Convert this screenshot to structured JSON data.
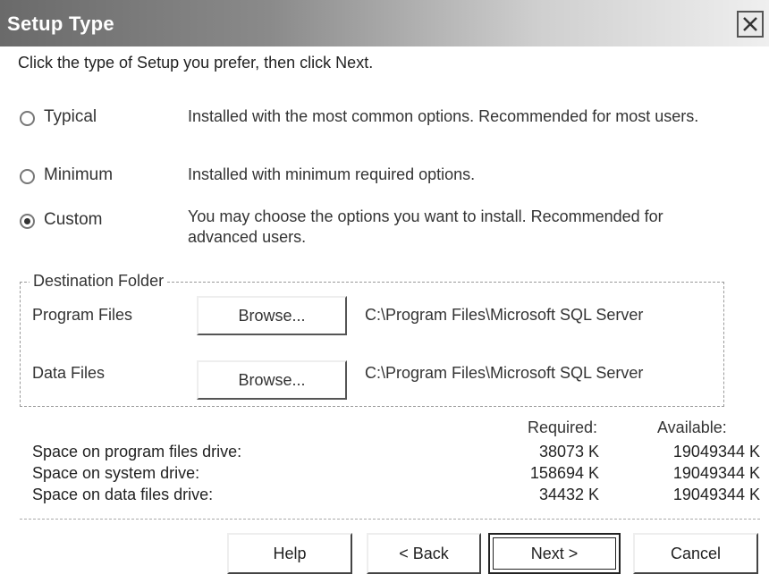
{
  "window": {
    "title": "Setup Type"
  },
  "instruction": "Click the type of Setup you prefer, then click Next.",
  "options": [
    {
      "label": "Typical",
      "description": "Installed with the most common options. Recommended for most users.",
      "selected": false
    },
    {
      "label": "Minimum",
      "description": "Installed with minimum required options.",
      "selected": false
    },
    {
      "label": "Custom",
      "description_line1": "You may choose the options you want to install. Recommended for",
      "description_line2": "advanced users.",
      "selected": true
    }
  ],
  "destination": {
    "legend": "Destination Folder",
    "program_files": {
      "label": "Program Files",
      "button": "Browse...",
      "path": "C:\\Program Files\\Microsoft SQL Server"
    },
    "data_files": {
      "label": "Data Files",
      "button": "Browse...",
      "path": "C:\\Program Files\\Microsoft SQL Server"
    }
  },
  "space": {
    "required_header": "Required:",
    "available_header": "Available:",
    "rows": [
      {
        "label": "Space on program files drive:",
        "required": "38073 K",
        "available": "19049344 K"
      },
      {
        "label": "Space on system drive:",
        "required": "158694 K",
        "available": "19049344 K"
      },
      {
        "label": "Space on data files drive:",
        "required": "34432 K",
        "available": "19049344 K"
      }
    ]
  },
  "buttons": {
    "help": "Help",
    "back": "< Back",
    "next": "Next >",
    "cancel": "Cancel"
  }
}
